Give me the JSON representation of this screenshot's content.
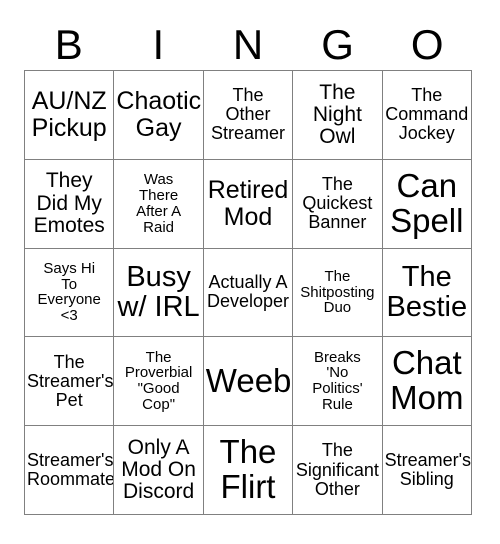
{
  "header": {
    "letters": [
      "B",
      "I",
      "N",
      "G",
      "O"
    ]
  },
  "grid": {
    "rows": 5,
    "columns": 5,
    "border_color": "#808080",
    "text_color": "#000000",
    "background_color": "#ffffff",
    "cells": [
      {
        "text": "AU/NZ\nPickup",
        "size": "lg"
      },
      {
        "text": "Chaotic\nGay",
        "size": "lg"
      },
      {
        "text": "The\nOther\nStreamer",
        "size": "sm"
      },
      {
        "text": "The\nNight\nOwl",
        "size": "md"
      },
      {
        "text": "The\nCommand\nJockey",
        "size": "sm"
      },
      {
        "text": "They\nDid My\nEmotes",
        "size": "md"
      },
      {
        "text": "Was\nThere\nAfter A\nRaid",
        "size": "xs"
      },
      {
        "text": "Retired\nMod",
        "size": "lg"
      },
      {
        "text": "The\nQuickest\nBanner",
        "size": "sm"
      },
      {
        "text": "Can\nSpell",
        "size": "xxl"
      },
      {
        "text": "Says Hi\nTo\nEveryone\n<3",
        "size": "xs"
      },
      {
        "text": "Busy\nw/ IRL",
        "size": "xl"
      },
      {
        "text": "Actually A\nDeveloper",
        "size": "sm"
      },
      {
        "text": "The\nShitposting\nDuo",
        "size": "xs"
      },
      {
        "text": "The\nBestie",
        "size": "xl"
      },
      {
        "text": "The\nStreamer's\nPet",
        "size": "sm"
      },
      {
        "text": "The\nProverbial\n\"Good\nCop\"",
        "size": "xs"
      },
      {
        "text": "Weeb",
        "size": "xxl"
      },
      {
        "text": "Breaks\n'No\nPolitics'\nRule",
        "size": "xs"
      },
      {
        "text": "Chat\nMom",
        "size": "xxl"
      },
      {
        "text": "Streamer's\nRoommate",
        "size": "sm"
      },
      {
        "text": "Only A\nMod On\nDiscord",
        "size": "md"
      },
      {
        "text": "The\nFlirt",
        "size": "xxl"
      },
      {
        "text": "The\nSignificant\nOther",
        "size": "sm"
      },
      {
        "text": "Streamer's\nSibling",
        "size": "sm"
      }
    ]
  }
}
